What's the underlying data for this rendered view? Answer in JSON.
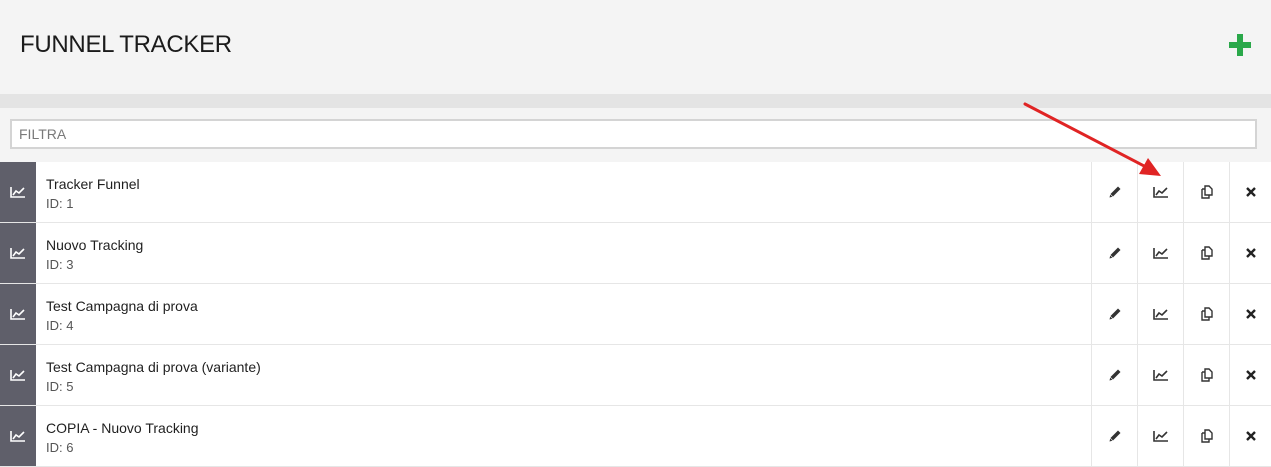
{
  "header": {
    "title": "FUNNEL TRACKER",
    "add_icon": "plus-icon",
    "accent_color": "#2aa84a"
  },
  "filter": {
    "placeholder": "FILTRA",
    "value": ""
  },
  "row_icon": "line-chart-icon",
  "row_actions": [
    "edit-pencil-icon",
    "stats-chart-icon",
    "duplicate-icon",
    "delete-x-icon"
  ],
  "items": [
    {
      "name": "Tracker Funnel",
      "id_label": "ID: 1"
    },
    {
      "name": "Nuovo Tracking",
      "id_label": "ID: 3"
    },
    {
      "name": "Test Campagna di prova",
      "id_label": "ID: 4"
    },
    {
      "name": "Test Campagna di prova (variante)",
      "id_label": "ID: 5"
    },
    {
      "name": "COPIA - Nuovo Tracking",
      "id_label": "ID: 6"
    }
  ],
  "annotation": {
    "type": "arrow",
    "color": "#e02424",
    "target": "stats-chart-icon of first row"
  }
}
